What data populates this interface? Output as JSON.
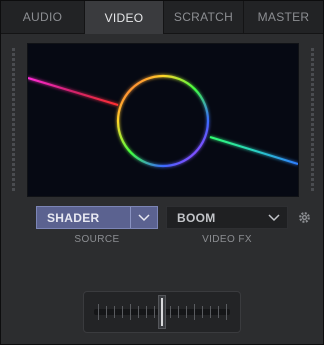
{
  "tabs": [
    {
      "label": "AUDIO"
    },
    {
      "label": "VIDEO"
    },
    {
      "label": "SCRATCH"
    },
    {
      "label": "MASTER"
    }
  ],
  "active_tab": "VIDEO",
  "source": {
    "value": "SHADER",
    "caption": "SOURCE"
  },
  "video_fx": {
    "value": "BOOM",
    "caption": "VIDEO FX"
  },
  "colors": {
    "accent": "#5b6290",
    "background": "#2c2d2f"
  },
  "icons": {
    "dropdown": "chevron-down-icon",
    "settings": "gear-icon"
  },
  "crossfader_position": 0.5
}
